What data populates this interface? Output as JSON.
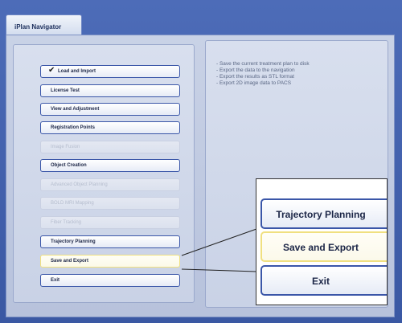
{
  "window": {
    "tab_title": "iPlan Navigator"
  },
  "nav": {
    "items": [
      {
        "label": "Load and Import",
        "state": "checked"
      },
      {
        "label": "License Test",
        "state": "enabled"
      },
      {
        "label": "View and Adjustment",
        "state": "enabled"
      },
      {
        "label": "Registration Points",
        "state": "enabled"
      },
      {
        "label": "Image Fusion",
        "state": "disabled"
      },
      {
        "label": "Object Creation",
        "state": "enabled"
      },
      {
        "label": "Advanced Object Planning",
        "state": "disabled"
      },
      {
        "label": "BOLD MRI Mapping",
        "state": "disabled"
      },
      {
        "label": "Fiber Tracking",
        "state": "disabled"
      },
      {
        "label": "Trajectory Planning",
        "state": "enabled"
      },
      {
        "label": "Save and Export",
        "state": "active"
      },
      {
        "label": "Exit",
        "state": "enabled"
      }
    ],
    "check_glyph": "✔"
  },
  "info": {
    "lines": [
      "- Save the current treatment plan to disk",
      "- Export the data to the navigation",
      "- Export the results as STL format",
      "- Export 2D image data to PACS"
    ]
  },
  "zoom": {
    "items": [
      {
        "label": "Trajectory Planning",
        "state": "enabled"
      },
      {
        "label": "Save and Export",
        "state": "active"
      },
      {
        "label": "Exit",
        "state": "enabled"
      }
    ]
  },
  "colors": {
    "window_blue": "#3a58a3",
    "button_border": "#3a56a8",
    "active_border": "#f0e080"
  }
}
